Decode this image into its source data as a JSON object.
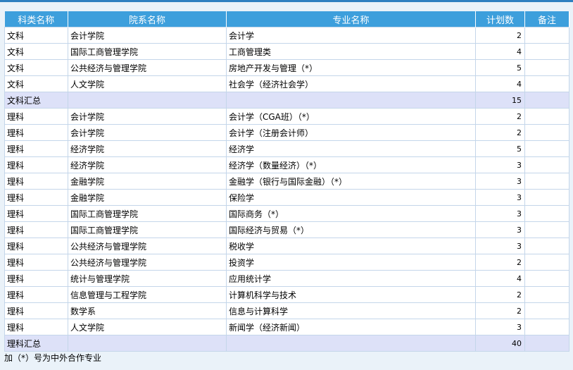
{
  "headers": [
    "科类名称",
    "院系名称",
    "专业名称",
    "计划数",
    "备注"
  ],
  "rows": [
    {
      "category": "文科",
      "college": "会计学院",
      "major": "会计学",
      "plan": "2",
      "note": ""
    },
    {
      "category": "文科",
      "college": "国际工商管理学院",
      "major": "工商管理类",
      "plan": "4",
      "note": ""
    },
    {
      "category": "文科",
      "college": "公共经济与管理学院",
      "major": "房地产开发与管理（*）",
      "plan": "5",
      "note": ""
    },
    {
      "category": "文科",
      "college": "人文学院",
      "major": "社会学（经济社会学）",
      "plan": "4",
      "note": ""
    },
    {
      "category": "文科汇总",
      "college": "",
      "major": "",
      "plan": "15",
      "note": "",
      "summary": true
    },
    {
      "category": "理科",
      "college": "会计学院",
      "major": "会计学（CGA班）（*）",
      "plan": "2",
      "note": ""
    },
    {
      "category": "理科",
      "college": "会计学院",
      "major": "会计学（注册会计师）",
      "plan": "2",
      "note": ""
    },
    {
      "category": "理科",
      "college": "经济学院",
      "major": "经济学",
      "plan": "5",
      "note": ""
    },
    {
      "category": "理科",
      "college": "经济学院",
      "major": "经济学（数量经济）（*）",
      "plan": "3",
      "note": ""
    },
    {
      "category": "理科",
      "college": "金融学院",
      "major": "金融学（银行与国际金融）（*）",
      "plan": "3",
      "note": ""
    },
    {
      "category": "理科",
      "college": "金融学院",
      "major": "保险学",
      "plan": "3",
      "note": ""
    },
    {
      "category": "理科",
      "college": "国际工商管理学院",
      "major": "国际商务（*）",
      "plan": "3",
      "note": ""
    },
    {
      "category": "理科",
      "college": "国际工商管理学院",
      "major": "国际经济与贸易（*）",
      "plan": "3",
      "note": ""
    },
    {
      "category": "理科",
      "college": "公共经济与管理学院",
      "major": "税收学",
      "plan": "3",
      "note": ""
    },
    {
      "category": "理科",
      "college": "公共经济与管理学院",
      "major": "投资学",
      "plan": "2",
      "note": ""
    },
    {
      "category": "理科",
      "college": "统计与管理学院",
      "major": "应用统计学",
      "plan": "4",
      "note": ""
    },
    {
      "category": "理科",
      "college": "信息管理与工程学院",
      "major": "计算机科学与技术",
      "plan": "2",
      "note": ""
    },
    {
      "category": "理科",
      "college": "数学系",
      "major": "信息与计算科学",
      "plan": "2",
      "note": ""
    },
    {
      "category": "理科",
      "college": "人文学院",
      "major": "新闻学（经济新闻）",
      "plan": "3",
      "note": ""
    },
    {
      "category": "理科汇总",
      "college": "",
      "major": "",
      "plan": "40",
      "note": "",
      "summary": true
    }
  ],
  "footnote": "加（*）号为中外合作专业"
}
